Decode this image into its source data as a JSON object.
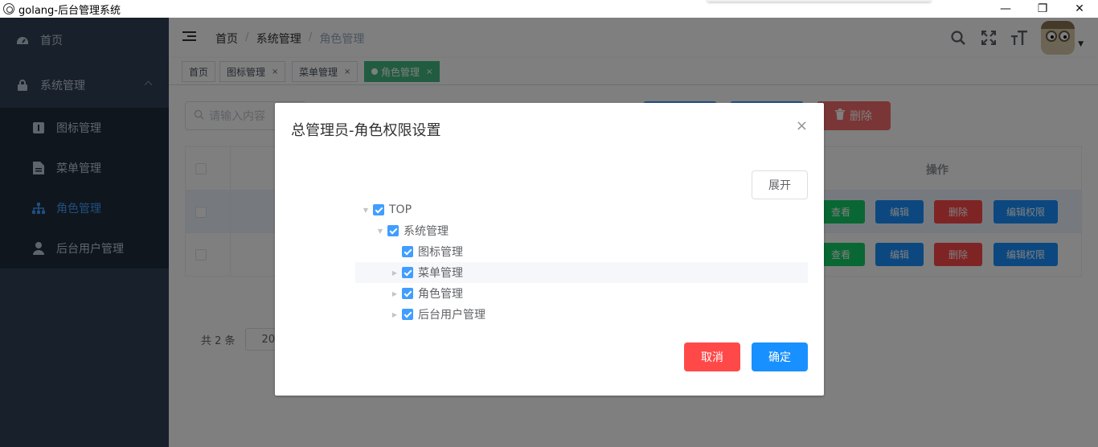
{
  "window": {
    "title": "golang-后台管理系统",
    "controls": [
      "—",
      "❐",
      "✕"
    ]
  },
  "sidebar": {
    "items": [
      {
        "label": "首页",
        "icon": "dashboard-icon"
      },
      {
        "label": "系统管理",
        "icon": "lock-icon"
      }
    ],
    "submenu": [
      {
        "label": "图标管理",
        "icon": "info-icon"
      },
      {
        "label": "菜单管理",
        "icon": "document-icon"
      },
      {
        "label": "角色管理",
        "icon": "tree-icon",
        "active": true
      },
      {
        "label": "后台用户管理",
        "icon": "user-icon"
      }
    ]
  },
  "navbar": {
    "breadcrumb": [
      "首页",
      "系统管理",
      "角色管理"
    ],
    "separator": "/",
    "icons": [
      "search-icon",
      "fullscreen-icon",
      "font-size-icon"
    ]
  },
  "tags": [
    {
      "label": "首页"
    },
    {
      "label": "图标管理",
      "close": "×"
    },
    {
      "label": "菜单管理",
      "close": "×"
    },
    {
      "label": "角色管理",
      "close": "×",
      "active": true
    }
  ],
  "main": {
    "search_placeholder": "请输入内容",
    "delete_label": "删除",
    "table_header_op": "操作",
    "row_buttons": {
      "view": "查看",
      "edit": "编辑",
      "delete": "删除",
      "edit_perm": "编辑权限"
    },
    "pager": {
      "total": "共 2 条",
      "size": "20"
    }
  },
  "dialog": {
    "title": "总管理员-角色权限设置",
    "close": "×",
    "expand_label": "展开",
    "tree": [
      {
        "label": "TOP",
        "level": 0,
        "toggle": "down",
        "checked": true
      },
      {
        "label": "系统管理",
        "level": 1,
        "toggle": "down",
        "checked": true
      },
      {
        "label": "图标管理",
        "level": 2,
        "toggle": "none",
        "checked": true
      },
      {
        "label": "菜单管理",
        "level": 2,
        "toggle": "right",
        "checked": true,
        "hover": true
      },
      {
        "label": "角色管理",
        "level": 2,
        "toggle": "right",
        "checked": true
      },
      {
        "label": "后台用户管理",
        "level": 2,
        "toggle": "right",
        "checked": true
      }
    ],
    "cancel_label": "取消",
    "confirm_label": "确定"
  },
  "colors": {
    "sidebar_bg": "#304156",
    "primary": "#409eff",
    "success": "#13ce66",
    "danger": "#ff4949",
    "tag_active": "#42b983"
  }
}
